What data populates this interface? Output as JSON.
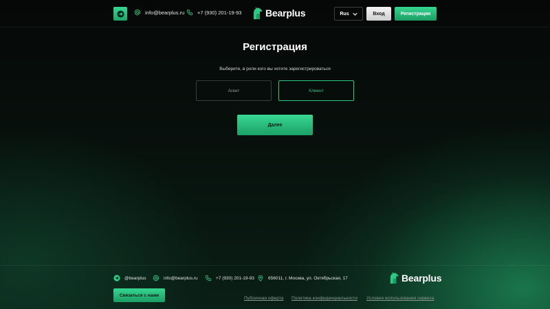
{
  "brand": {
    "name": "Bearplus",
    "accent": "#2fc884",
    "accent_dark": "#1b9c63"
  },
  "header": {
    "email": "info@bearplus.ru",
    "phone": "+7 (930) 201-19-93",
    "language": "Rus",
    "login_label": "Вход",
    "register_label": "Регистрация"
  },
  "main": {
    "title": "Регистрация",
    "subtitle": "Выберите, в роли кого вы хотите зарегистрироваться",
    "roles": [
      {
        "label": "Агент",
        "selected": false
      },
      {
        "label": "Клиент",
        "selected": true
      }
    ],
    "next_label": "Далее"
  },
  "footer": {
    "telegram": "@bearplus",
    "email": "info@bearplus.ru",
    "phone": "+7 (930) 201-19-93",
    "address": "656011, г. Москва, ул. Октябрьская, 17",
    "contact_button": "Связаться с нами",
    "links": [
      "Публичная оферта",
      "Политика конфиденциальности",
      "Условия использования сервиса"
    ]
  },
  "icons": [
    "telegram-icon",
    "at-sign-icon",
    "phone-icon",
    "location-pin-icon",
    "chevron-down-icon",
    "bear-logo-icon"
  ]
}
